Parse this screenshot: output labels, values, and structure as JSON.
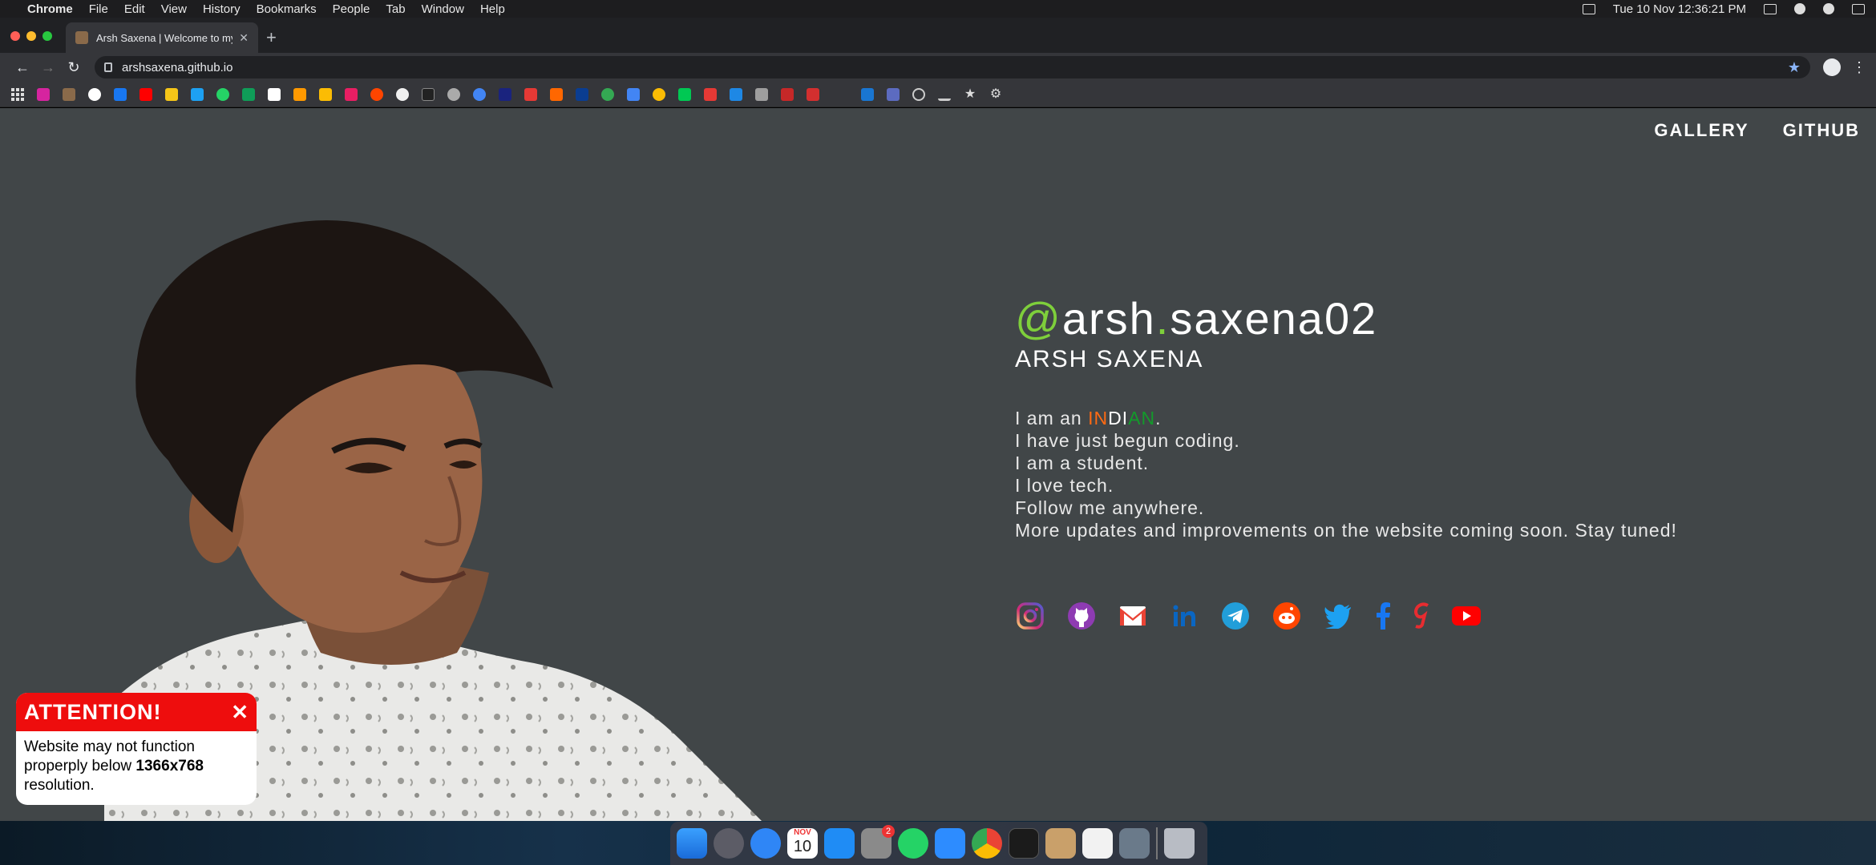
{
  "menubar": {
    "app_name": "Chrome",
    "items": [
      "File",
      "Edit",
      "View",
      "History",
      "Bookmarks",
      "People",
      "Tab",
      "Window",
      "Help"
    ],
    "clock": "Tue 10 Nov  12:36:21 PM"
  },
  "browser": {
    "tab_title": "Arsh Saxena | Welcome to my",
    "url": "arshsaxena.github.io"
  },
  "nav": {
    "gallery": "GALLERY",
    "github": "GITHUB"
  },
  "profile": {
    "handle_at": "@",
    "handle_part1": "arsh",
    "handle_dot": ".",
    "handle_part2": "saxena02",
    "name": "ARSH SAXENA",
    "bio_prefix": "I am an ",
    "bio_in": "IN",
    "bio_di": "DI",
    "bio_an": "AN",
    "bio_suffix": ".",
    "bio_lines": [
      "I have just begun coding.",
      "I am a student.",
      "I love tech.",
      "Follow me anywhere.",
      "More updates and improvements on the website coming soon. Stay tuned!"
    ]
  },
  "socials": [
    "instagram-icon",
    "github-icon",
    "gmail-icon",
    "linkedin-icon",
    "telegram-icon",
    "reddit-icon",
    "twitter-icon",
    "facebook-icon",
    "gaana-icon",
    "youtube-icon"
  ],
  "attention": {
    "title": "ATTENTION!",
    "close": "✕",
    "msg_part1": "Website may not function properply below ",
    "msg_bold": "1366x768",
    "msg_part2": " resolution."
  },
  "dock": {
    "calendar_month": "NOV",
    "calendar_day": "10",
    "badge": "2"
  },
  "colors": {
    "page_bg": "#414648",
    "accent_green": "#7ecf3b",
    "attention_red": "#ee0d0d"
  }
}
